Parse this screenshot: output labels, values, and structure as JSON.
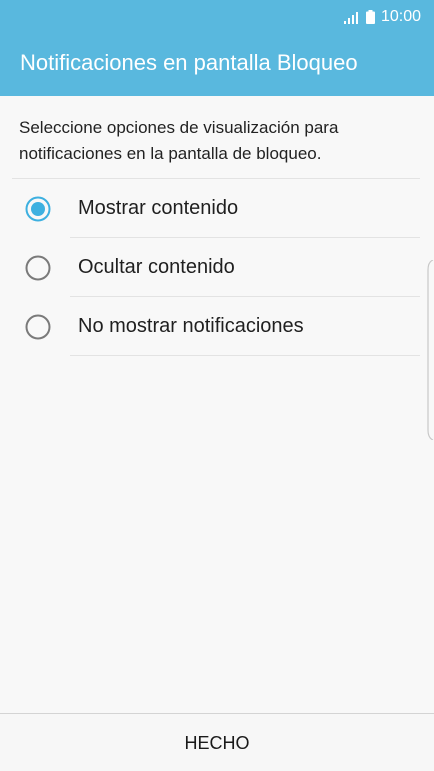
{
  "status_bar": {
    "time": "10:00",
    "signal_icon": "signal-icon",
    "battery_icon": "battery-icon"
  },
  "header": {
    "title": "Notificaciones en pantalla Bloqueo"
  },
  "main": {
    "description": "Seleccione opciones de visualización para notificaciones en la pantalla de bloqueo.",
    "options": [
      {
        "label": "Mostrar contenido",
        "selected": true
      },
      {
        "label": "Ocultar contenido",
        "selected": false
      },
      {
        "label": "No mostrar notificaciones",
        "selected": false
      }
    ]
  },
  "footer": {
    "done_label": "HECHO"
  },
  "colors": {
    "accent": "#59b8de",
    "radio_selected": "#3db0e0",
    "radio_unselected": "#7a7a7a"
  }
}
